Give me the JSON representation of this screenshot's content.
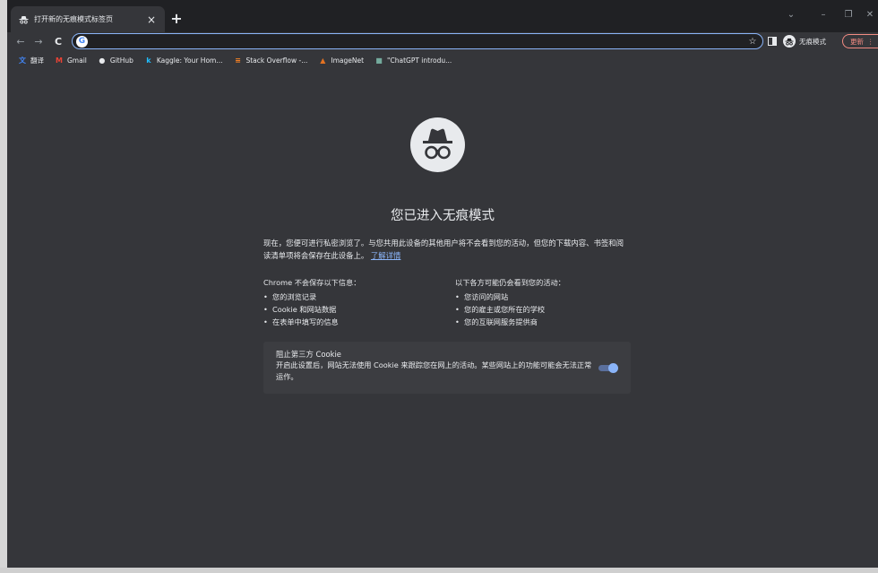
{
  "tab": {
    "title": "打开新的无痕模式标签页",
    "close": "×",
    "new_tab": "+"
  },
  "window_controls": {
    "dropdown": "⌄",
    "minimize": "–",
    "restore": "❐",
    "close": "✕"
  },
  "toolbar": {
    "back": "←",
    "forward": "→",
    "reload": "C",
    "omnibox_value": "",
    "star": "☆",
    "incognito_label": "无痕模式",
    "update_label": "更新"
  },
  "bookmarks": [
    {
      "label": "翻译",
      "icon": "translate-icon",
      "color": "#4285f4"
    },
    {
      "label": "Gmail",
      "icon": "gmail-icon",
      "color": "#ea4335"
    },
    {
      "label": "GitHub",
      "icon": "github-icon",
      "color": "#e8eaed"
    },
    {
      "label": "Kaggle: Your Hom...",
      "icon": "kaggle-icon",
      "color": "#20beff"
    },
    {
      "label": "Stack Overflow -...",
      "icon": "stackoverflow-icon",
      "color": "#f48024"
    },
    {
      "label": "ImageNet",
      "icon": "imagenet-icon",
      "color": "#e37222"
    },
    {
      "label": "\"ChatGPT introdu...",
      "icon": "chatgpt-icon",
      "color": "#74aa9c"
    }
  ],
  "content": {
    "heading": "您已进入无痕模式",
    "intro_text": "现在，您便可进行私密浏览了。与您共用此设备的其他用户将不会看到您的活动，但您的下载内容、书签和阅读清单项将会保存在此设备上。",
    "learn_more": "了解详情",
    "left_col": {
      "head": "Chrome 不会保存以下信息：",
      "items": [
        "您的浏览记录",
        "Cookie 和网站数据",
        "在表单中填写的信息"
      ]
    },
    "right_col": {
      "head": "以下各方可能仍会看到您的活动：",
      "items": [
        "您访问的网站",
        "您的雇主或您所在的学校",
        "您的互联网服务提供商"
      ]
    },
    "cookie": {
      "title": "阻止第三方 Cookie",
      "desc": "开启此设置后，网站无法使用 Cookie 来跟踪您在网上的活动。某些网站上的功能可能会无法正常运作。",
      "enabled": true
    }
  },
  "colors": {
    "accent": "#8ab4f8",
    "background": "#35363a",
    "tabstrip": "#202124",
    "update": "#f28b82"
  }
}
